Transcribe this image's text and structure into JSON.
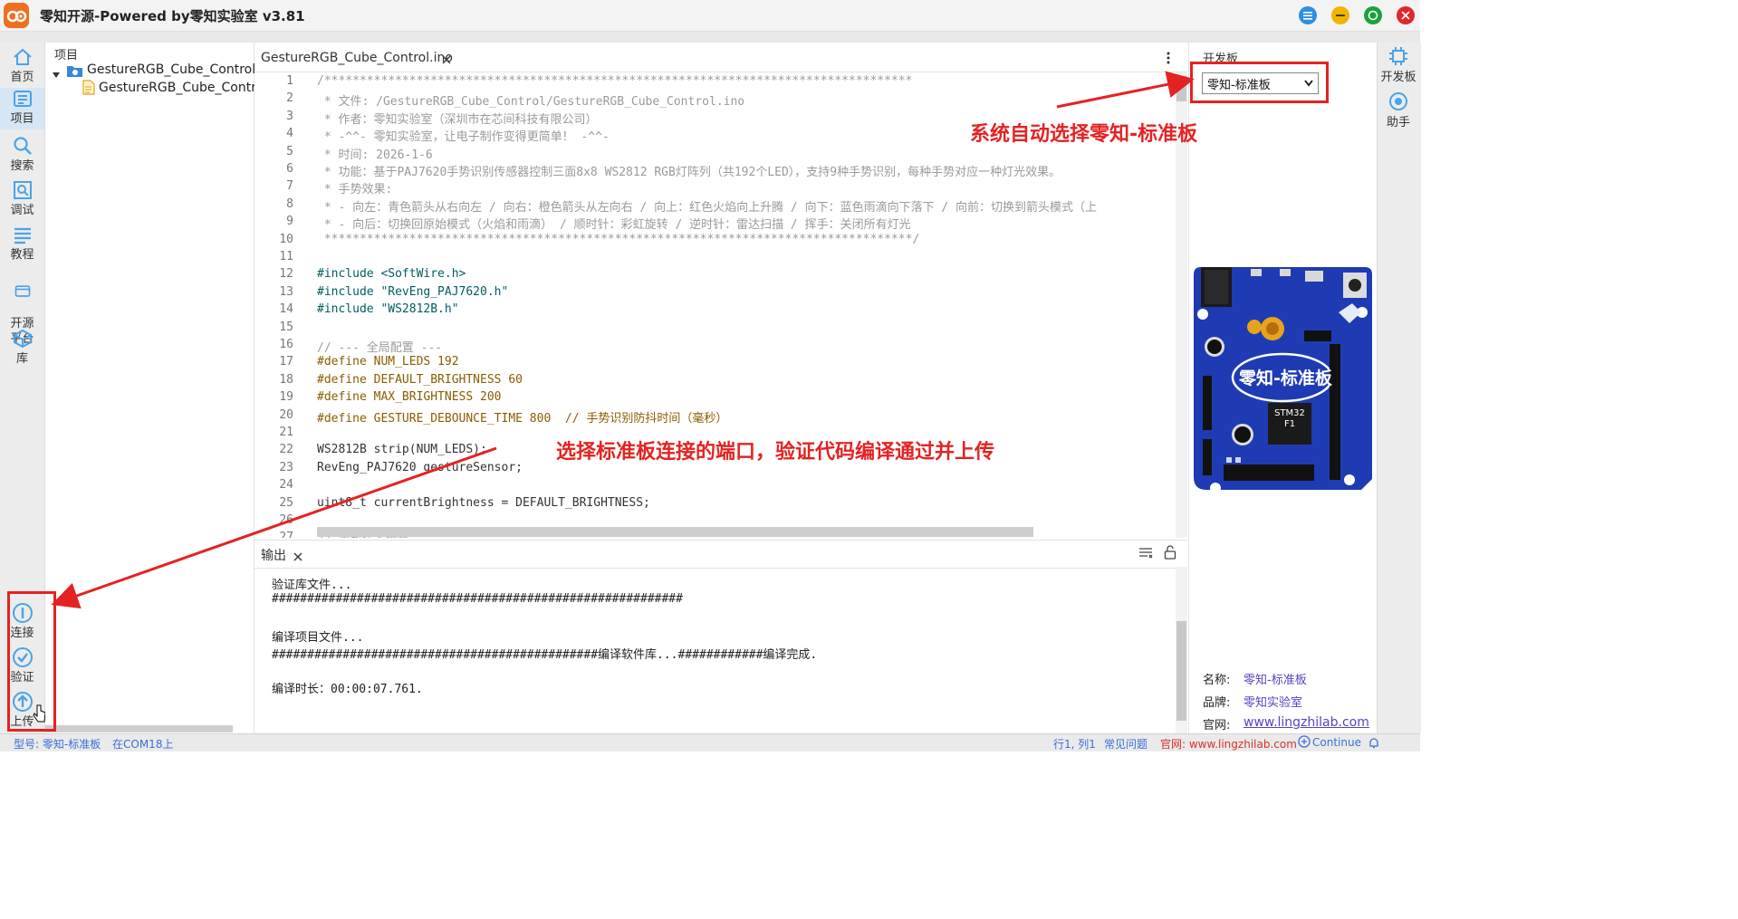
{
  "window": {
    "title": "零知开源-Powered by零知实验室 v3.81"
  },
  "left_bar": {
    "items": [
      {
        "label": "首页"
      },
      {
        "label": "项目"
      },
      {
        "label": "搜索"
      },
      {
        "label": "调试"
      },
      {
        "label": "教程"
      },
      {
        "label": "开源\n平台"
      },
      {
        "label": "库"
      }
    ],
    "bottom": [
      {
        "label": "连接"
      },
      {
        "label": "验证"
      },
      {
        "label": "上传"
      }
    ]
  },
  "project_tree": {
    "header": "项目",
    "folder": "GestureRGB_Cube_Control",
    "file": "GestureRGB_Cube_Control"
  },
  "editor": {
    "tab_label": "GestureRGB_Cube_Control.ino",
    "lines": [
      "/***********************************************************************************",
      " * 文件: /GestureRGB_Cube_Control/GestureRGB_Cube_Control.ino",
      " * 作者：零知实验室（深圳市在芯间科技有限公司）",
      " * -^^- 零知实验室，让电子制作变得更简单！ -^^-",
      " * 时间: 2026-1-6",
      " * 功能：基于PAJ7620手势识别传感器控制三面8x8 WS2812 RGB灯阵列（共192个LED），支持9种手势识别，每种手势对应一种灯光效果。",
      " * 手势效果:",
      " * - 向左：青色箭头从右向左 / 向右：橙色箭头从左向右 / 向上：红色火焰向上升腾 / 向下：蓝色雨滴向下落下 / 向前：切换到箭头模式（上",
      " * - 向后：切换回原始模式（火焰和雨滴） / 顺时针：彩虹旋转 / 逆时针：雷达扫描 / 挥手：关闭所有灯光",
      " ***********************************************************************************/",
      "",
      "#include <SoftWire.h>",
      "#include \"RevEng_PAJ7620.h\"",
      "#include \"WS2812B.h\"",
      "",
      "// --- 全局配置 ---",
      "#define NUM_LEDS 192",
      "#define DEFAULT_BRIGHTNESS 60",
      "#define MAX_BRIGHTNESS 200",
      "#define GESTURE_DEBOUNCE_TIME 800  // 手势识别防抖时间（毫秒）",
      "",
      "WS2812B strip(NUM_LEDS);",
      "RevEng_PAJ7620 gestureSensor;",
      "",
      "uint8_t currentBrightness = DEFAULT_BRIGHTNESS;",
      "",
      "// 手势状态枚举"
    ]
  },
  "output": {
    "tab_label": "输出",
    "lines": [
      "验证库文件...",
      "##########################################################",
      "",
      "编译项目文件...",
      "##############################################编译软件库...############编译完成.",
      "",
      "编译时长：00:00:07.761."
    ]
  },
  "board_panel": {
    "label": "开发板",
    "selected": "零知-标准板",
    "board_name_on_pcb": "零知-标准板",
    "chip_label": "STM32\nF1",
    "info": [
      {
        "key": "名称:",
        "value": "零知-标准板"
      },
      {
        "key": "品牌:",
        "value": "零知实验室"
      },
      {
        "key": "官网:",
        "value": "www.lingzhilab.com"
      }
    ]
  },
  "right_bar": {
    "items": [
      {
        "label": "开发板"
      },
      {
        "label": "助手"
      }
    ]
  },
  "status_bar": {
    "model": "型号: 零知-标准板",
    "port": "在COM18上",
    "cursor": "行1, 列1",
    "faq": "常见问题",
    "website": "官网: www.lingzhilab.com",
    "continue": "Continue"
  },
  "annotations": {
    "board_note": "系统自动选择零知-标准板",
    "upload_note": "选择标准板连接的端口，验证代码编译通过并上传"
  },
  "colors": {
    "accent": "#3a86d8",
    "annotation": "#e52222",
    "board": "#1f3bb3",
    "link": "#5b3fc4"
  }
}
